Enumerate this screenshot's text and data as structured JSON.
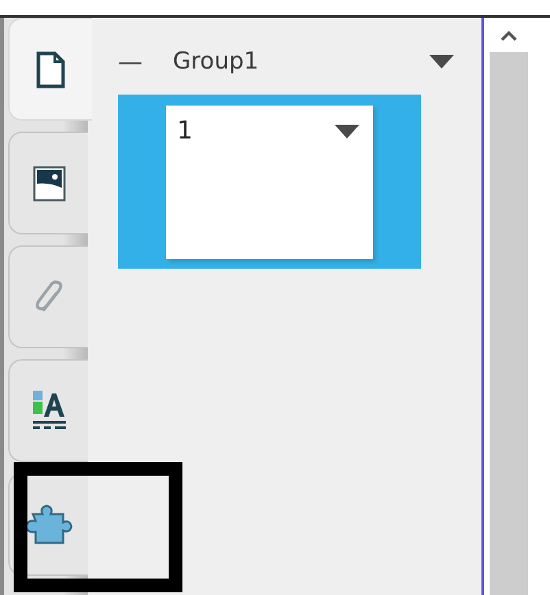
{
  "tabs": [
    {
      "kind": "document",
      "selected": true,
      "highlighted": false
    },
    {
      "kind": "image",
      "selected": false,
      "highlighted": false
    },
    {
      "kind": "paperclip",
      "selected": false,
      "highlighted": false
    },
    {
      "kind": "textstyle",
      "selected": false,
      "highlighted": false
    },
    {
      "kind": "puzzle",
      "selected": false,
      "highlighted": true
    }
  ],
  "group": {
    "toggle": "—",
    "title": "Group1",
    "expanded": true
  },
  "pages": [
    {
      "label": "1",
      "selected": true
    }
  ]
}
